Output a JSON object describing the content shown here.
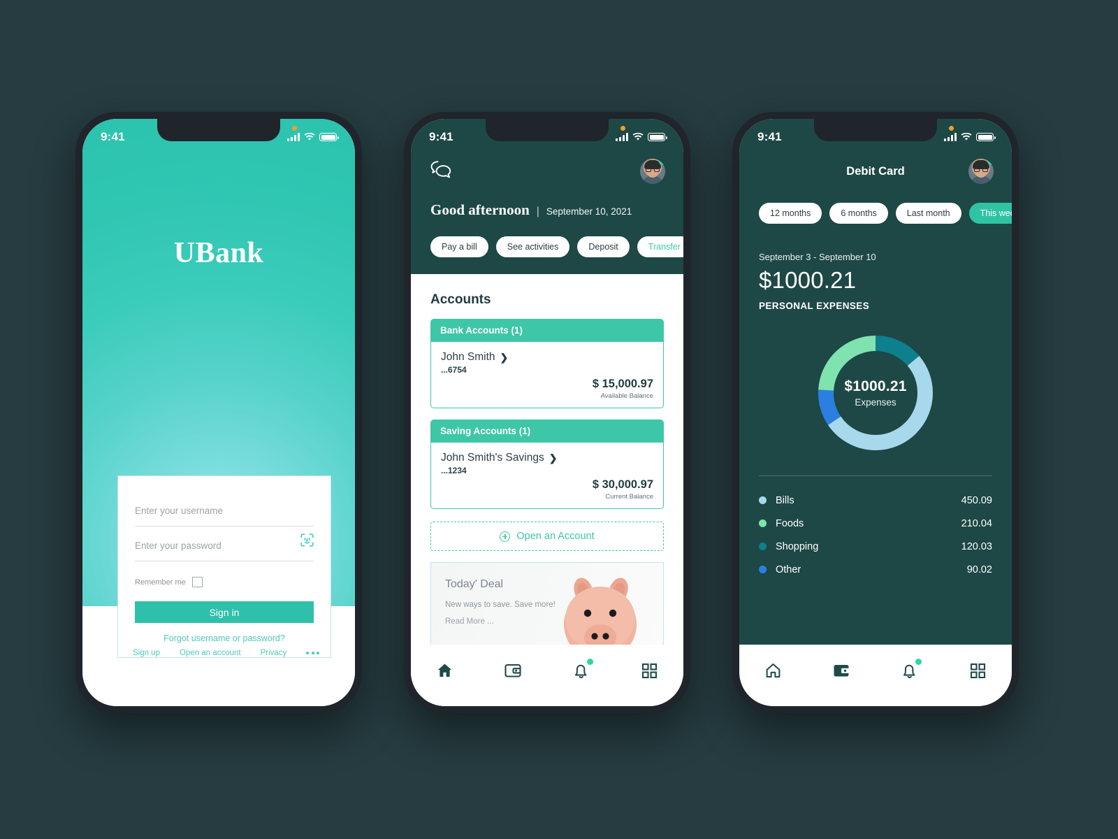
{
  "theme": {
    "page_bg": "#263c40",
    "brand_teal": "#2fc3a4",
    "dark_header": "#1e4845",
    "accent_link": "#4fc9b9"
  },
  "status_bar": {
    "time": "9:41",
    "signal_icon": "signal-bars-icon",
    "wifi_icon": "wifi-icon",
    "battery_icon": "battery-icon"
  },
  "login": {
    "brand": "UBank",
    "username_placeholder": "Enter your username",
    "username_value": "",
    "password_placeholder": "Enter your password",
    "password_value": "",
    "faceid_icon": "face-id-icon",
    "remember_label": "Remember me",
    "signin_label": "Sign in",
    "forgot_label": "Forgot username or password?",
    "links": [
      "Sign up",
      "Open an account",
      "Privacy"
    ],
    "more_icon": "more-dots-icon"
  },
  "home": {
    "chat_icon": "chat-bubbles-icon",
    "avatar": "user-avatar",
    "greeting": "Good afternoon",
    "separator": "|",
    "date": "September 10, 2021",
    "quick_actions": [
      {
        "label": "Pay a bill",
        "accent": false
      },
      {
        "label": "See activities",
        "accent": false
      },
      {
        "label": "Deposit",
        "accent": false
      },
      {
        "label": "Transfer",
        "accent": true
      }
    ],
    "section_title": "Accounts",
    "groups": [
      {
        "header": "Bank Accounts (1)",
        "name": "John Smith",
        "number": "...6754",
        "amount": "$ 15,000.97",
        "sub": "Available Balance"
      },
      {
        "header": "Saving Accounts (1)",
        "name": "John Smith's Savings",
        "number": "...1234",
        "amount": "$ 30,000.97",
        "sub": "Current Balance"
      }
    ],
    "open_account_label": "Open an Account",
    "open_account_icon": "plus-circle-icon",
    "deal": {
      "title": "Today' Deal",
      "subtitle": "New ways to save. Save more!",
      "read_more": "Read More ...",
      "image": "piggy-bank-image"
    }
  },
  "card": {
    "title": "Debit Card",
    "filters": [
      {
        "label": "12 months",
        "active": false
      },
      {
        "label": "6 months",
        "active": false
      },
      {
        "label": "Last month",
        "active": false
      },
      {
        "label": "This week",
        "active": true
      }
    ],
    "date_range": "September 3 - September 10",
    "total": "$1000.21",
    "total_label": "PERSONAL EXPENSES",
    "donut_center_amount": "$1000.21",
    "donut_center_label": "Expenses"
  },
  "chart_data": {
    "type": "pie",
    "title": "Personal Expenses",
    "subtitle": "September 3 - September 10",
    "total": 1000.21,
    "currency": "$",
    "legend_position": "below",
    "categories": [
      "Bills",
      "Foods",
      "Shopping",
      "Other"
    ],
    "values": [
      450.09,
      210.04,
      120.03,
      90.02
    ],
    "value_labels": [
      "450.09",
      "210.04",
      "120.03",
      "90.02"
    ],
    "colors": [
      "#a8d8ec",
      "#7fe3b0",
      "#0e7f8c",
      "#2b7fe0"
    ],
    "donut": true,
    "inner_radius_ratio": 0.72,
    "start_angle_deg": 0,
    "slice_order_clockwise": [
      "Shopping",
      "Bills",
      "Other",
      "Foods"
    ]
  },
  "bottom_nav": [
    {
      "icon": "home-icon",
      "label": "home"
    },
    {
      "icon": "wallet-icon",
      "label": "wallet"
    },
    {
      "icon": "bell-icon",
      "label": "notifications",
      "badge": true
    },
    {
      "icon": "grid-icon",
      "label": "more"
    }
  ]
}
